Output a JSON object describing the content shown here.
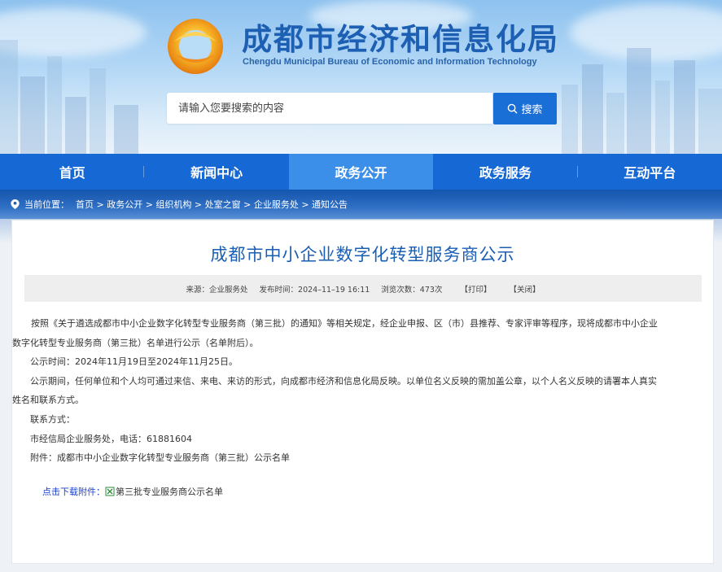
{
  "header": {
    "title_cn": "成都市经济和信息化局",
    "title_en": "Chengdu Municipal Bureau of Economic and Information Technology",
    "search_placeholder": "请输入您要搜索的内容",
    "search_button": "搜索"
  },
  "nav": {
    "items": [
      {
        "label": "首页"
      },
      {
        "label": "新闻中心"
      },
      {
        "label": "政务公开"
      },
      {
        "label": "政务服务"
      },
      {
        "label": "互动平台"
      }
    ],
    "active_index": 2
  },
  "breadcrumb": {
    "prefix": "当前位置：",
    "path": "首页 > 政务公开 > 组织机构 > 处室之窗 > 企业服务处 > 通知公告"
  },
  "article": {
    "title": "成都市中小企业数字化转型服务商公示",
    "meta": {
      "source": "来源：企业服务处",
      "published": "发布时间：2024–11–19 16:11",
      "views": "浏览次数：473次",
      "print": "【打印】",
      "close": "【关闭】"
    },
    "paragraph1_line1": "按照《关于遴选成都市中小企业数字化转型专业服务商（第三批）的通知》等相关规定，经企业申报、区（市）县推荐、专家评审等程序，现将成都市中小企业",
    "paragraph1_line2": "数字化转型专业服务商（第三批）名单进行公示（名单附后）。",
    "notice_period": "公示时间：2024年11月19日至2024年11月25日。",
    "paragraph3_line1": "公示期间，任何单位和个人均可通过来信、来电、来访的形式，向成都市经济和信息化局反映。以单位名义反映的需加盖公章，以个人名义反映的请署本人真实",
    "paragraph3_line2": "姓名和联系方式。",
    "contact_label": "联系方式：",
    "contact": "市经信局企业服务处，电话：61881604",
    "attachment_note": "附件：成都市中小企业数字化转型专业服务商（第三批）公示名单",
    "download_label": "点击下载附件：",
    "download_file": "第三批专业服务商公示名单"
  },
  "colors": {
    "brand_blue": "#1668d4",
    "nav_active": "#3b8fe8",
    "title_blue": "#1a5fb4",
    "search_button": "#1a6fd6",
    "download_label": "#1a3fd0"
  },
  "icons": [
    "logo-emblem",
    "search-icon",
    "location-pin-icon",
    "excel-file-icon"
  ]
}
